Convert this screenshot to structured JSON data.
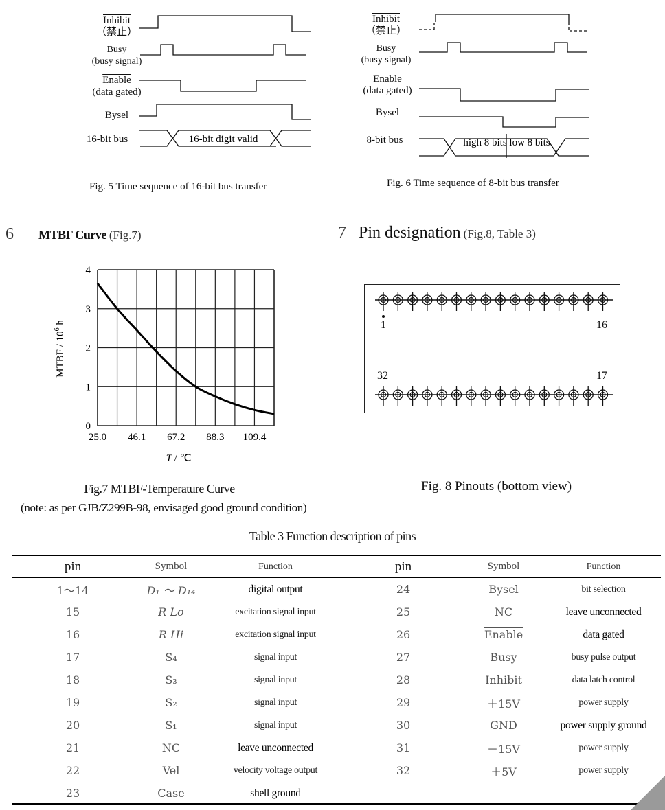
{
  "fig5": {
    "signals": [
      {
        "label": "Inhibit",
        "sub": "（禁止）",
        "overline": true
      },
      {
        "label": "Busy",
        "sub": "(busy signal)",
        "overline": false
      },
      {
        "label": "Enable",
        "sub": "(data gated)",
        "overline": true
      },
      {
        "label": "Bysel",
        "sub": "",
        "overline": false
      },
      {
        "label": "16-bit bus",
        "sub": "",
        "overline": false
      }
    ],
    "bus_text": "16-bit digit valid",
    "caption": "Fig. 5 Time sequence of 16-bit bus transfer"
  },
  "fig6": {
    "signals": [
      {
        "label": "Inhibit",
        "sub": "（禁止）",
        "overline": true
      },
      {
        "label": "Busy",
        "sub": "(busy signal)",
        "overline": false
      },
      {
        "label": "Enable",
        "sub": "(data gated)",
        "overline": true
      },
      {
        "label": "Bysel",
        "sub": "",
        "overline": false
      },
      {
        "label": "8-bit bus",
        "sub": "",
        "overline": false
      }
    ],
    "bus_text_high": "high 8 bits",
    "bus_text_low": "low 8 bits",
    "caption": "Fig. 6 Time sequence of 8-bit bus transfer"
  },
  "section6": {
    "num": "6",
    "title": "MTBF Curve",
    "ref": "(Fig.7)"
  },
  "section7": {
    "num": "7",
    "title": "Pin designation",
    "ref": "(Fig.8, Table 3)"
  },
  "chart_data": {
    "type": "line",
    "title": "Fig.7  MTBF-Temperature Curve",
    "note": "(note: as per GJB/Z299B-98, envisaged good ground condition)",
    "xlabel": "T / ℃",
    "ylabel": "MTBF / 10^6 h",
    "xlim": [
      25.0,
      119.95
    ],
    "ylim": [
      0,
      4
    ],
    "xticks": [
      "25.0",
      "46.1",
      "67.2",
      "88.3",
      "109.4"
    ],
    "yticks": [
      "0",
      "1",
      "2",
      "3",
      "4"
    ],
    "grid": true,
    "x": [
      25.0,
      35.55,
      46.1,
      56.65,
      67.2,
      77.75,
      88.3,
      98.85,
      109.4,
      119.95
    ],
    "series": [
      {
        "name": "MTBF",
        "values": [
          3.65,
          3.0,
          2.45,
          1.9,
          1.4,
          1.0,
          0.75,
          0.55,
          0.4,
          0.3
        ]
      }
    ]
  },
  "fig8": {
    "caption": "Fig. 8 Pinouts (bottom view)",
    "label_pin1": "1",
    "label_pin16": "16",
    "label_pin32": "32",
    "label_pin17": "17",
    "pins_per_row": 16
  },
  "table3": {
    "title": "Table 3  Function description of pins",
    "headers": {
      "pin": "pin",
      "symbol": "Symbol",
      "function": "Function"
    },
    "left": [
      {
        "pin": "1～14",
        "symbol": "D₁ ～ D₁₄",
        "function": "digital output",
        "bold": true
      },
      {
        "pin": "15",
        "symbol": "R Lo",
        "function": "excitation signal input",
        "bold": false
      },
      {
        "pin": "16",
        "symbol": "R Hi",
        "function": "excitation signal input",
        "bold": false
      },
      {
        "pin": "17",
        "symbol": "S₄",
        "function": "signal input",
        "bold": false
      },
      {
        "pin": "18",
        "symbol": "S₃",
        "function": "signal input",
        "bold": false
      },
      {
        "pin": "19",
        "symbol": "S₂",
        "function": "signal input",
        "bold": false
      },
      {
        "pin": "20",
        "symbol": "S₁",
        "function": "signal input",
        "bold": false
      },
      {
        "pin": "21",
        "symbol": "NC",
        "function": "leave unconnected",
        "bold": true
      },
      {
        "pin": "22",
        "symbol": "Vel",
        "function": "velocity voltage output",
        "bold": false
      },
      {
        "pin": "23",
        "symbol": "Case",
        "function": "shell ground",
        "bold": true
      }
    ],
    "right": [
      {
        "pin": "24",
        "symbol": "Bysel",
        "function": "bit selection",
        "bold": false,
        "overline": false
      },
      {
        "pin": "25",
        "symbol": "NC",
        "function": "leave unconnected",
        "bold": true,
        "overline": false
      },
      {
        "pin": "26",
        "symbol": "Enable",
        "function": "data gated",
        "bold": true,
        "overline": true
      },
      {
        "pin": "27",
        "symbol": "Busy",
        "function": "busy pulse output",
        "bold": false,
        "overline": false
      },
      {
        "pin": "28",
        "symbol": "Inhibit",
        "function": "data latch control",
        "bold": false,
        "overline": true
      },
      {
        "pin": "29",
        "symbol": "＋15V",
        "function": "power supply",
        "bold": false,
        "overline": false
      },
      {
        "pin": "30",
        "symbol": "GND",
        "function": "power supply ground",
        "bold": true,
        "overline": false
      },
      {
        "pin": "31",
        "symbol": "－15V",
        "function": "power supply",
        "bold": false,
        "overline": false
      },
      {
        "pin": "32",
        "symbol": "＋5V",
        "function": "power supply",
        "bold": false,
        "overline": false
      }
    ]
  }
}
